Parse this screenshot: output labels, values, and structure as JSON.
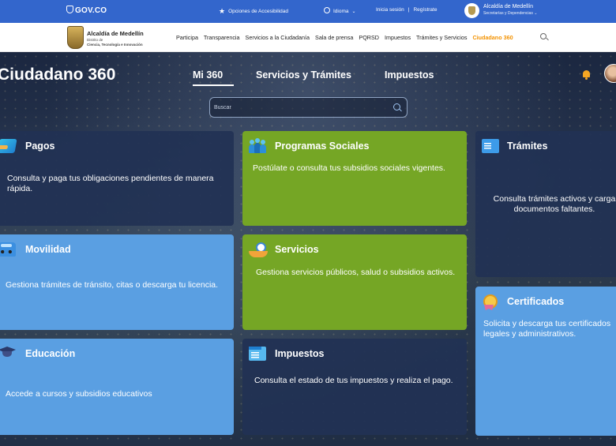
{
  "gov_bar": {
    "logo_text": "GOV.CO",
    "accessibility_label": "Opciones de Accesibilidad",
    "language_label": "Idioma",
    "login_label": "Inicia sesión",
    "separator": "|",
    "register_label": "Regístrate",
    "org_name": "Alcaldía de Medellín",
    "org_sub": "Secretarías y Dependencias"
  },
  "nav": {
    "logo_title": "Alcaldía de Medellín",
    "logo_line2": "Distrito de",
    "logo_line3": "Ciencia, Tecnología e Innovación",
    "links": [
      "Participa",
      "Transparencia",
      "Servicios a la Ciudadanía",
      "Sala de prensa",
      "PQRSD",
      "Impuestos",
      "Trámites y Servicios",
      "Ciudadano 360"
    ],
    "active_link": "Ciudadano 360",
    "active_color": "#f39200"
  },
  "hero": {
    "title": "Ciudadano 360",
    "tabs": [
      "Mi 360",
      "Servicios y Trámites",
      "Impuestos"
    ],
    "active_tab": "Mi 360",
    "search_placeholder": "Buscar",
    "search_value": ""
  },
  "cards": [
    {
      "id": "pagos",
      "title": "Pagos",
      "description": "Consulta y paga tus obligaciones pendientes de manera rápida.",
      "icon": "credit-card-icon",
      "color": "#213154"
    },
    {
      "id": "programas",
      "title": "Programas Sociales",
      "description": "Postúlate o consulta tus subsidios sociales vigentes.",
      "icon": "people-icon",
      "color": "#75a625"
    },
    {
      "id": "tramites",
      "title": "Trámites",
      "description": "Consulta trámites activos y carga documentos faltantes.",
      "icon": "document-icon",
      "color": "#213154"
    },
    {
      "id": "movilidad",
      "title": "Movilidad",
      "description": "Gestiona trámites de tránsito, citas o descarga tu licencia.",
      "icon": "car-icon",
      "color": "#5a9fe2"
    },
    {
      "id": "servicios",
      "title": "Servicios",
      "description": "Gestiona servicios públicos, salud o subsidios activos.",
      "icon": "hand-service-icon",
      "color": "#75a625"
    },
    {
      "id": "certificados",
      "title": "Certificados",
      "description": "Solicita y descarga tus certificados legales y administrativos.",
      "icon": "medal-icon",
      "color": "#5a9fe2"
    },
    {
      "id": "educacion",
      "title": "Educación",
      "description": "Accede a cursos y subsidios educativos",
      "icon": "graduation-cap-icon",
      "color": "#5a9fe2"
    },
    {
      "id": "impuestos",
      "title": "Impuestos",
      "description": "Consulta el estado de tus impuestos y realiza el pago.",
      "icon": "tax-calendar-icon",
      "color": "#213154"
    }
  ]
}
